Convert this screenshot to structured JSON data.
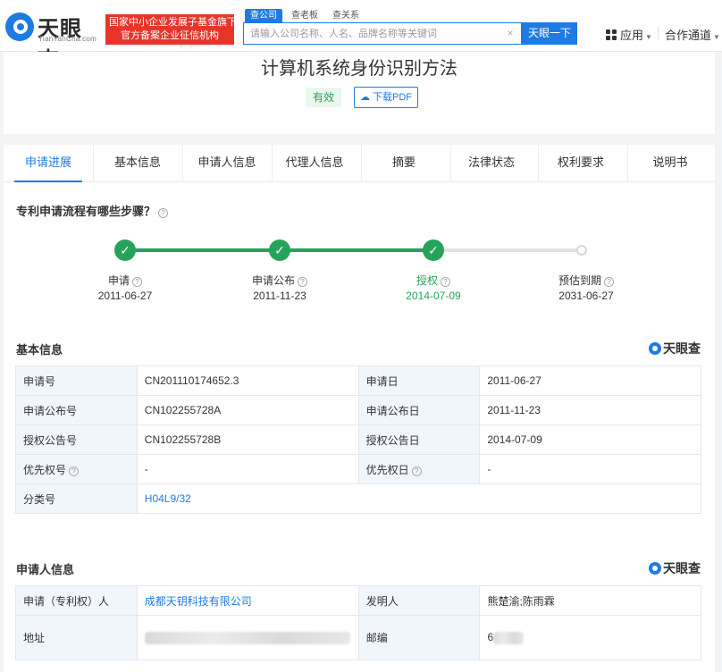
{
  "header": {
    "logo_cn": "天眼查",
    "logo_en": "TianYanCha.com",
    "promo_line1": "国家中小企业发展子基金旗下",
    "promo_line2": "官方备案企业征信机构",
    "search_tabs": [
      "查公司",
      "查老板",
      "查关系"
    ],
    "search_placeholder": "请输入公司名称、人名、品牌名称等关键词",
    "search_button": "天眼一下",
    "apps_label": "应用",
    "coop_label": "合作通道"
  },
  "patent": {
    "title": "计算机系统身份识别方法",
    "status": "有效",
    "pdf_label": "下载PDF"
  },
  "tabs": [
    "申请进展",
    "基本信息",
    "申请人信息",
    "代理人信息",
    "摘要",
    "法律状态",
    "权利要求",
    "说明书"
  ],
  "progress": {
    "title": "专利申请流程有哪些步骤？",
    "steps": [
      {
        "label": "申请",
        "date": "2011-06-27",
        "done": true
      },
      {
        "label": "申请公布",
        "date": "2011-11-23",
        "done": true
      },
      {
        "label": "授权",
        "date": "2014-07-09",
        "done": true
      },
      {
        "label": "预估到期",
        "date": "2031-06-27",
        "done": false
      }
    ]
  },
  "basic": {
    "title": "基本信息",
    "brand": "天眼查",
    "rows": [
      {
        "k1": "申请号",
        "v1": "CN201110174652.3",
        "k2": "申请日",
        "v2": "2011-06-27"
      },
      {
        "k1": "申请公布号",
        "v1": "CN102255728A",
        "k2": "申请公布日",
        "v2": "2011-11-23"
      },
      {
        "k1": "授权公告号",
        "v1": "CN102255728B",
        "k2": "授权公告日",
        "v2": "2014-07-09"
      },
      {
        "k1": "优先权号",
        "v1": "-",
        "k2": "优先权日",
        "v2": "-"
      }
    ],
    "class_key": "分类号",
    "class_val": "H04L9/32"
  },
  "applicant": {
    "title": "申请人信息",
    "brand": "天眼查",
    "applicant_key": "申请（专利权）人",
    "applicant_val": "成都天钥科技有限公司",
    "inventor_key": "发明人",
    "inventor_val": "熊楚渝;陈雨霖",
    "address_key": "地址",
    "zip_key": "邮编",
    "zip_val": "6"
  }
}
